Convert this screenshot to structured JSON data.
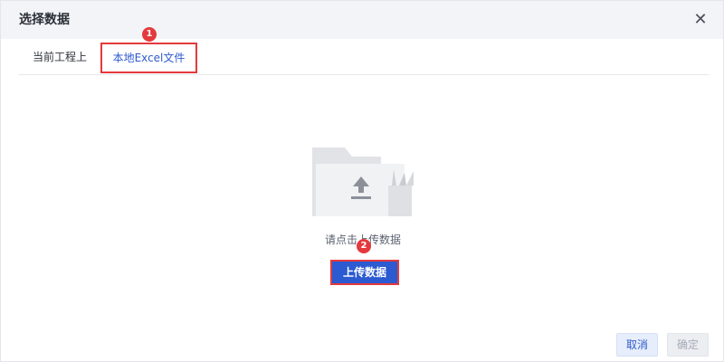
{
  "dialog": {
    "title": "选择数据",
    "close_icon": "close-icon"
  },
  "tabs": [
    {
      "label": "当前工程上"
    },
    {
      "label": "本地Excel文件"
    }
  ],
  "badges": [
    "1",
    "2"
  ],
  "upload": {
    "hint": "请点击上传数据",
    "button_label": "上传数据",
    "illustration_icon": "folder-upload-icon"
  },
  "footer": {
    "cancel_label": "取消",
    "ok_label": "确定"
  },
  "colors": {
    "accent": "#2b5ad1",
    "annotation": "#e4393c",
    "header_bg": "#f3f4f7"
  }
}
